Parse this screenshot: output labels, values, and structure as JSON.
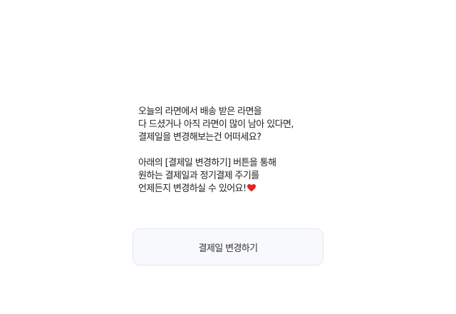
{
  "message": {
    "paragraph1": [
      "오늘의 라면에서 배송 받은 라면을",
      "다 드셨거나 아직 라면이 많이 남아 있다면,",
      "결제일을 변경해보는건 어떠세요?"
    ],
    "paragraph2": [
      "아래의 [결제일 변경하기] 버튼을 통해",
      "원하는 결제일과 정기결제 주기를",
      "언제든지 변경하실 수 있어요!"
    ],
    "heart_icon": "heart-icon",
    "heart_color": "#e02424"
  },
  "button": {
    "label": "결제일 변경하기"
  }
}
